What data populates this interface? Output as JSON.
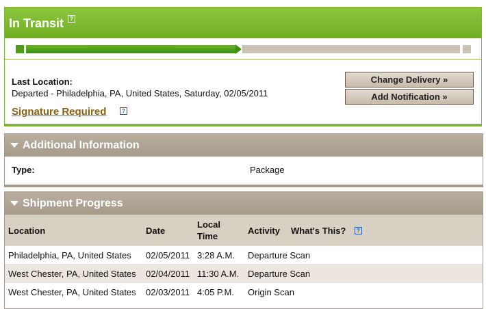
{
  "status": {
    "title": "In Transit",
    "help": "?"
  },
  "progress": {
    "fraction_complete": 0.5
  },
  "last_location": {
    "label": "Last Location:",
    "text": "Departed - Philadelphia, PA, United States, Saturday, 02/05/2011"
  },
  "signature": {
    "label": "Signature Required",
    "help": "?"
  },
  "buttons": {
    "change_delivery": "Change Delivery »",
    "add_notification": "Add Notification »"
  },
  "additional": {
    "title": "Additional Information",
    "type_label": "Type:",
    "type_value": "Package"
  },
  "shipment": {
    "title": "Shipment Progress",
    "headers": {
      "location": "Location",
      "date": "Date",
      "local_time_1": "Local",
      "local_time_2": "Time",
      "activity": "Activity",
      "whats_this": "What's This?",
      "help": "?"
    },
    "rows": [
      {
        "location": "Philadelphia, PA, United States",
        "date": "02/05/2011",
        "time": "3:28 A.M.",
        "activity": "Departure Scan"
      },
      {
        "location": "West Chester, PA, United States",
        "date": "02/04/2011",
        "time": "11:30 A.M.",
        "activity": "Departure Scan"
      },
      {
        "location": "West Chester, PA, United States",
        "date": "02/03/2011",
        "time": "4:05 P.M.",
        "activity": "Origin Scan"
      }
    ]
  },
  "colors": {
    "green": "#6fae23",
    "taupe": "#a69a8a",
    "link_brown": "#8a6010"
  }
}
